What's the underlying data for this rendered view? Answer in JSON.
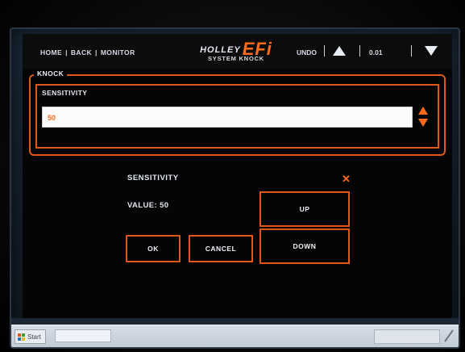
{
  "nav": {
    "home": "HOME",
    "back": "BACK",
    "monitor": "MONITOR"
  },
  "brand": {
    "name": "HOLLEY",
    "efi": "EFi",
    "subtitle": "SYSTEM KNOCK"
  },
  "toolbar": {
    "undo": "UNDO",
    "step": "0.01",
    "up_icon": "triangle-up-icon",
    "down_icon": "triangle-down-icon"
  },
  "knock_group": {
    "legend": "KNOCK",
    "sensitivity_label": "SENSITIVITY",
    "sensitivity_value": "50"
  },
  "dialog": {
    "title": "SENSITIVITY",
    "value_label": "VALUE: 50",
    "up": "UP",
    "down": "DOWN",
    "ok": "OK",
    "cancel": "CANCEL"
  },
  "taskbar": {
    "start": "Start"
  },
  "colors": {
    "accent": "#e0571b",
    "brand_orange": "#ff6a1c",
    "background": "#050505",
    "text": "#e7ebf3"
  }
}
